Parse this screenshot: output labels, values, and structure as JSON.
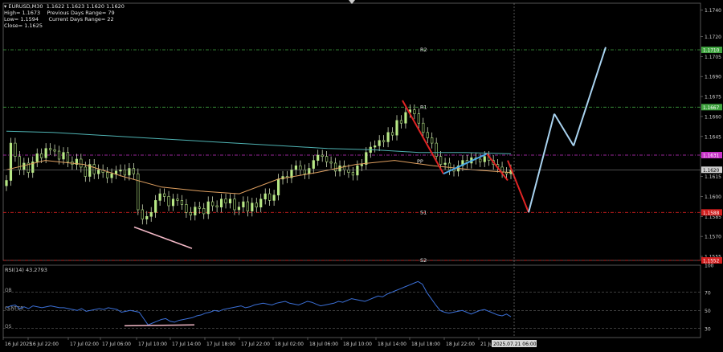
{
  "header": {
    "symbol_line": "EURUSD,M30  1.1622 1.1623 1.1620 1.1620",
    "high_line": "High= 1.1673",
    "prev_range_line": "Previous Days Range= 79",
    "low_line": "Low= 1.1594",
    "curr_range_line": "Current Days Range= 22",
    "close_line": "Close= 1.1625"
  },
  "chart_data": {
    "type": "candlestick",
    "symbol": "EURUSD",
    "timeframe": "M30",
    "main_axis": {
      "ylim": [
        1.1552,
        1.1745
      ],
      "ticks": [
        "1.1740",
        "1.1720",
        "1.1705",
        "1.1690",
        "1.1675",
        "1.1660",
        "1.1645",
        "1.1630",
        "1.1615",
        "1.1600",
        "1.1585",
        "1.1570",
        "1.1555"
      ]
    },
    "levels": [
      {
        "name": "R2",
        "price": 1.171,
        "label": "1.1710",
        "color": "#3fa33f"
      },
      {
        "name": "R1",
        "price": 1.1667,
        "label": "1.1667",
        "color": "#3fa33f"
      },
      {
        "name": "PP",
        "price": 1.1631,
        "label": "1.1631",
        "color": "#c733c7"
      },
      {
        "name": "S1",
        "price": 1.1588,
        "label": "1.1588",
        "color": "#d21e1e"
      },
      {
        "name": "S2",
        "price": 1.1552,
        "label": "1.1552",
        "color": "#d21e1e"
      }
    ],
    "current_price": {
      "value": 1.162,
      "label": "1.1620"
    },
    "candle_closes": [
      1.1612,
      1.164,
      1.163,
      1.162,
      1.1625,
      1.1618,
      1.1626,
      1.1632,
      1.1629,
      1.1636,
      1.1635,
      1.1634,
      1.1628,
      1.1633,
      1.1626,
      1.1624,
      1.1628,
      1.1622,
      1.1615,
      1.1624,
      1.1617,
      1.162,
      1.1618,
      1.1614,
      1.1617,
      1.1619,
      1.162,
      1.1616,
      1.1621,
      1.1617,
      1.159,
      1.1583,
      1.1585,
      1.1588,
      1.1597,
      1.1602,
      1.16,
      1.1593,
      1.1598,
      1.1597,
      1.1594,
      1.1588,
      1.1586,
      1.1592,
      1.1591,
      1.1587,
      1.1596,
      1.1593,
      1.1592,
      1.1598,
      1.1595,
      1.1598,
      1.159,
      1.1592,
      1.1596,
      1.1589,
      1.1595,
      1.1592,
      1.1598,
      1.1602,
      1.1597,
      1.1601,
      1.1613,
      1.1615,
      1.1614,
      1.162,
      1.1623,
      1.162,
      1.1617,
      1.1621,
      1.1627,
      1.1631,
      1.163,
      1.1626,
      1.1625,
      1.1619,
      1.1623,
      1.162,
      1.1618,
      1.1616,
      1.1623,
      1.1624,
      1.1633,
      1.1637,
      1.1638,
      1.1642,
      1.1641,
      1.1648,
      1.1646,
      1.1657,
      1.1655,
      1.1663,
      1.1665,
      1.1662,
      1.1655,
      1.1648,
      1.1644,
      1.164,
      1.163,
      1.1624,
      1.1625,
      1.162,
      1.1619,
      1.1623,
      1.1627,
      1.1625,
      1.1629,
      1.1628,
      1.1626,
      1.163,
      1.1627,
      1.1624,
      1.1622,
      1.1618,
      1.1617,
      1.162
    ],
    "moving_averages": [
      {
        "color": "#4fb3b3",
        "values": [
          1.1649,
          1.1648,
          1.1646,
          1.1644,
          1.1642,
          1.164,
          1.1638,
          1.1636,
          1.1635,
          1.1633,
          1.1633,
          1.1632
        ]
      },
      {
        "color": "#e0a060",
        "values": [
          1.162,
          1.1627,
          1.1624,
          1.1615,
          1.1607,
          1.1604,
          1.1602,
          1.1613,
          1.1618,
          1.1624,
          1.1627,
          1.1623,
          1.162,
          1.1618
        ]
      }
    ],
    "projection": {
      "red": [
        [
          1.1672,
          1.1617
        ],
        [
          1.1627,
          1.1588
        ]
      ],
      "blue": [
        [
          1.1617,
          1.1632
        ]
      ],
      "light_blue": [
        [
          1.1588,
          1.1662
        ],
        [
          1.1662,
          1.1638
        ],
        [
          1.1638,
          1.1712
        ]
      ]
    },
    "rsi": {
      "label": "RSI(14) 43.2793",
      "ylim": [
        20,
        100
      ],
      "ticks": [
        "100",
        "70",
        "50",
        "30"
      ],
      "levels": [
        {
          "name": "OB",
          "value": 70
        },
        {
          "name": "CENTER",
          "value": 50
        },
        {
          "name": "OS",
          "value": 30
        }
      ],
      "values": [
        53,
        55,
        56,
        52,
        54,
        52,
        55,
        54,
        53,
        54,
        55,
        54,
        53,
        53,
        52,
        51,
        50,
        52,
        49,
        50,
        51,
        52,
        51,
        53,
        52,
        51,
        48,
        49,
        50,
        49,
        48,
        41,
        34,
        36,
        38,
        40,
        41,
        38,
        37,
        39,
        40,
        41,
        42,
        44,
        45,
        47,
        48,
        50,
        49,
        51,
        52,
        53,
        54,
        55,
        53,
        54,
        56,
        57,
        58,
        57,
        56,
        58,
        59,
        60,
        58,
        57,
        56,
        58,
        60,
        59,
        57,
        55,
        56,
        57,
        58,
        60,
        59,
        61,
        63,
        62,
        61,
        60,
        62,
        64,
        66,
        65,
        68,
        70,
        72,
        74,
        76,
        78,
        80,
        82,
        79,
        70,
        63,
        56,
        50,
        48,
        47,
        48,
        49,
        50,
        48,
        46,
        48,
        50,
        51,
        49,
        47,
        45,
        44,
        46,
        43
      ],
      "divergence": [
        [
          31,
          33
        ],
        [
          36,
          34
        ]
      ]
    },
    "x_ticks": [
      "16 Jul 2025",
      "16 Jul 22:00",
      "17 Jul 02:00",
      "17 Jul 06:00",
      "17 Jul 10:00",
      "17 Jul 14:00",
      "17 Jul 18:00",
      "17 Jul 22:00",
      "18 Jul 02:00",
      "18 Jul 06:00",
      "18 Jul 10:00",
      "18 Jul 14:00",
      "18 Jul 18:00",
      "18 Jul 22:00",
      "21 Jul"
    ],
    "x_highlight": "2025.07.21 06:00"
  }
}
